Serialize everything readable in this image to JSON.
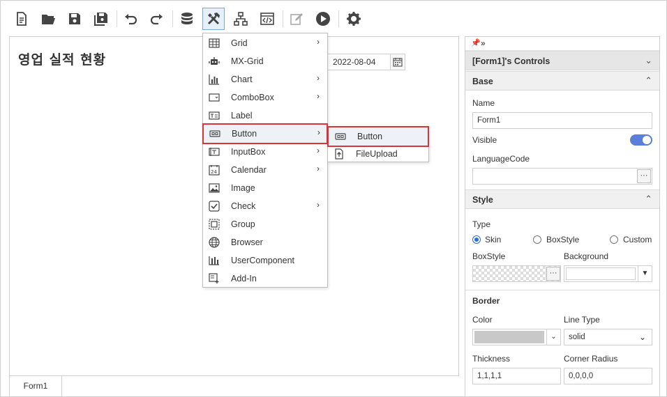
{
  "toolbar": {
    "buttons": [
      "new-file",
      "open-folder",
      "save",
      "save-all",
      "undo",
      "redo",
      "database",
      "tools",
      "hierarchy",
      "code-view",
      "edit",
      "run",
      "settings"
    ]
  },
  "canvas": {
    "form_title": "영업 실적 현황",
    "date_value": "2022-08-04",
    "tab_label": "Form1"
  },
  "menu": {
    "items": [
      {
        "label": "Grid",
        "has_submenu": true
      },
      {
        "label": "MX-Grid",
        "has_submenu": false
      },
      {
        "label": "Chart",
        "has_submenu": true
      },
      {
        "label": "ComboBox",
        "has_submenu": true
      },
      {
        "label": "Label",
        "has_submenu": false
      },
      {
        "label": "Button",
        "has_submenu": true
      },
      {
        "label": "InputBox",
        "has_submenu": true
      },
      {
        "label": "Calendar",
        "has_submenu": true
      },
      {
        "label": "Image",
        "has_submenu": false
      },
      {
        "label": "Check",
        "has_submenu": true
      },
      {
        "label": "Group",
        "has_submenu": false
      },
      {
        "label": "Browser",
        "has_submenu": false
      },
      {
        "label": "UserComponent",
        "has_submenu": false
      },
      {
        "label": "Add-In",
        "has_submenu": false
      }
    ],
    "submenu": [
      {
        "label": "Button"
      },
      {
        "label": "FileUpload"
      }
    ]
  },
  "panel": {
    "pin_glyphs": "▾ »",
    "header": "[Form1]'s Controls",
    "base": {
      "title": "Base",
      "name_label": "Name",
      "name_value": "Form1",
      "visible_label": "Visible",
      "visible_on": true,
      "language_label": "LanguageCode",
      "language_value": "",
      "ellipsis": "···"
    },
    "style": {
      "title": "Style",
      "type_label": "Type",
      "type_options": [
        "Skin",
        "BoxStyle",
        "Custom"
      ],
      "type_selected": "Skin",
      "boxstyle_label": "BoxStyle",
      "background_label": "Background",
      "ellipsis": "···"
    },
    "border": {
      "title": "Border",
      "color_label": "Color",
      "line_type_label": "Line Type",
      "line_type_value": "solid",
      "thickness_label": "Thickness",
      "thickness_value": "1,1,1,1",
      "corner_label": "Corner Radius",
      "corner_value": "0,0,0,0"
    }
  },
  "colors": {
    "accent_red": "#d9343b",
    "toggle_blue": "#5b7fd8",
    "radio_blue": "#2a6fd6"
  }
}
